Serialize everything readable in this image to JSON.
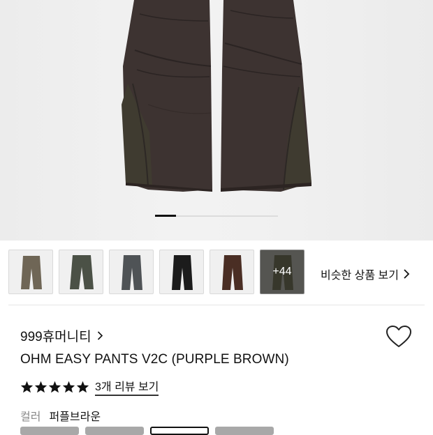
{
  "gallery": {
    "current_slide": 1,
    "hero_alt": "",
    "more_count_label": "+44",
    "similar_label": "비슷한 상품 보기",
    "thumbnails": [
      {
        "color": "#6f6656",
        "name": "thumb-khaki"
      },
      {
        "color": "#4b5146",
        "name": "thumb-olive-grey"
      },
      {
        "color": "#4f5356",
        "name": "thumb-charcoal"
      },
      {
        "color": "#1c1c1c",
        "name": "thumb-black"
      },
      {
        "color": "#4a2e24",
        "name": "thumb-brown"
      },
      {
        "color": "#4a4a30",
        "name": "thumb-more"
      }
    ]
  },
  "product": {
    "brand": "999휴머니티",
    "title": "OHM EASY PANTS V2C (PURPLE BROWN)",
    "rating": 5,
    "reviews_label": "3개 리뷰 보기",
    "color_label": "컬러",
    "color_value": "퍼플브라운"
  },
  "colors": {
    "star": "#111111",
    "pants_main": "#3b3230",
    "pants_side": "#3e3a30"
  }
}
